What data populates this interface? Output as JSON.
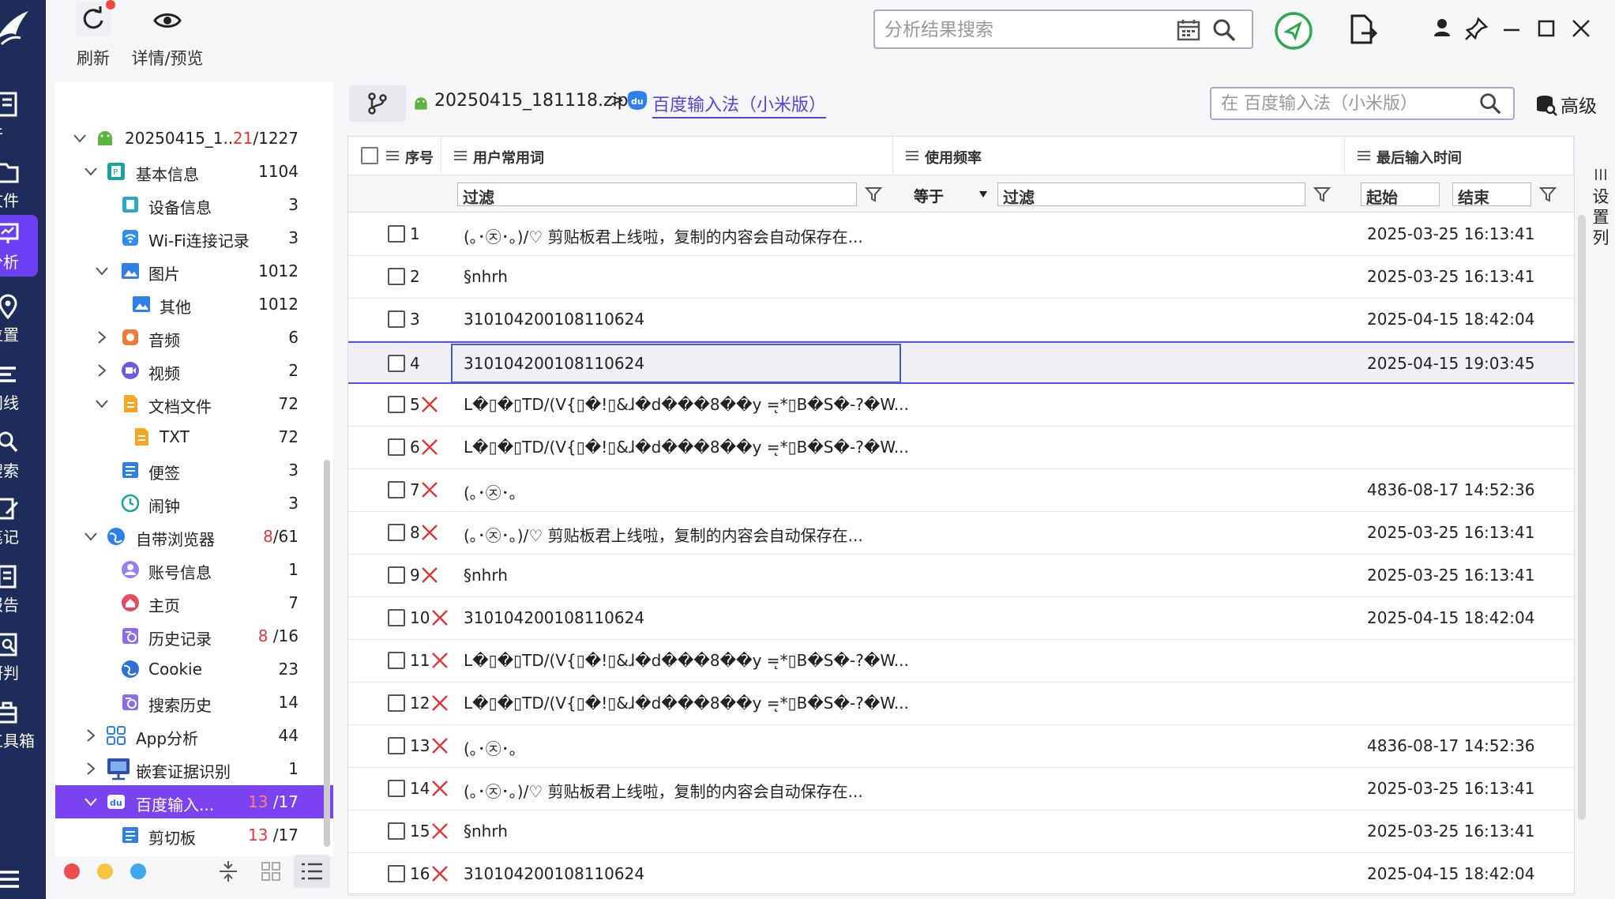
{
  "toolbar": {
    "refresh_label": "刷新",
    "preview_label": "详情/预览",
    "search_placeholder": "分析结果搜索"
  },
  "rail": {
    "items": [
      {
        "label": "件",
        "icon": "document-icon"
      },
      {
        "label": "文件",
        "icon": "folder-icon"
      },
      {
        "label": "分析",
        "icon": "analysis-icon"
      },
      {
        "label": "位置",
        "icon": "location-icon"
      },
      {
        "label": "间线",
        "icon": "timeline-icon"
      },
      {
        "label": "搜索",
        "icon": "search-icon"
      },
      {
        "label": "笔记",
        "icon": "note-icon"
      },
      {
        "label": "报告",
        "icon": "report-icon"
      },
      {
        "label": "研判",
        "icon": "judge-icon"
      },
      {
        "label": "工具箱",
        "icon": "toolbox-icon"
      }
    ]
  },
  "tree": {
    "nodes": [
      {
        "label": "20250415_1...",
        "count_red": "21",
        "count": "/1227"
      },
      {
        "label": "基本信息",
        "count_red": "",
        "count": "1104"
      },
      {
        "label": "设备信息",
        "count_red": "",
        "count": "3"
      },
      {
        "label": "Wi-Fi连接记录",
        "count_red": "",
        "count": "3"
      },
      {
        "label": "图片",
        "count_red": "",
        "count": "1012"
      },
      {
        "label": "其他",
        "count_red": "",
        "count": "1012"
      },
      {
        "label": "音频",
        "count_red": "",
        "count": "6"
      },
      {
        "label": "视频",
        "count_red": "",
        "count": "2"
      },
      {
        "label": "文档文件",
        "count_red": "",
        "count": "72"
      },
      {
        "label": "TXT",
        "count_red": "",
        "count": "72"
      },
      {
        "label": "便签",
        "count_red": "",
        "count": "3"
      },
      {
        "label": "闹钟",
        "count_red": "",
        "count": "3"
      },
      {
        "label": "自带浏览器",
        "count_red": "8",
        "count": "/61"
      },
      {
        "label": "账号信息",
        "count_red": "",
        "count": "1"
      },
      {
        "label": "主页",
        "count_red": "",
        "count": "7"
      },
      {
        "label": "历史记录",
        "count_red": "8",
        "count": " /16"
      },
      {
        "label": "Cookie",
        "count_red": "",
        "count": "23"
      },
      {
        "label": "搜索历史",
        "count_red": "",
        "count": "14"
      },
      {
        "label": "App分析",
        "count_red": "",
        "count": "44"
      },
      {
        "label": "嵌套证据识别",
        "count_red": "",
        "count": "1"
      },
      {
        "label": "百度输入...",
        "count_red": "13",
        "count": " /17"
      },
      {
        "label": "剪切板",
        "count_red": "13",
        "count": " /17"
      }
    ]
  },
  "breadcrumb": {
    "archive": "20250415_181118.zip",
    "separator": ">",
    "app": "百度输入法（小米版）"
  },
  "app_search": {
    "placeholder": "在 百度输入法（小米版）"
  },
  "advanced_label": "高级",
  "columns": {
    "seq": "序号",
    "word": "用户常用词",
    "freq": "使用频率",
    "last_time": "最后输入时间"
  },
  "filters": {
    "word": "过滤",
    "freq_op": "等于",
    "freq": "过滤",
    "start": "起始",
    "end": "结束"
  },
  "column_settings": "设置列",
  "rows": [
    {
      "no": "1",
      "deleted": false,
      "word": "(｡･㉨･｡)/♡ 剪贴板君上线啦，复制的内容会自动保存在...",
      "time": "2025-03-25 16:13:41"
    },
    {
      "no": "2",
      "deleted": false,
      "word": "§nhrh",
      "time": "2025-03-25 16:13:41"
    },
    {
      "no": "3",
      "deleted": false,
      "word": "310104200108110624",
      "time": "2025-04-15 18:42:04"
    },
    {
      "no": "4",
      "deleted": false,
      "word": "310104200108110624",
      "time": "2025-04-15 19:03:45"
    },
    {
      "no": "5",
      "deleted": true,
      "word": "L�▯�▯TD/(V{▯�!▯&ɺ�d���8��y =̨*▯B�S�-?�W...",
      "time": ""
    },
    {
      "no": "6",
      "deleted": true,
      "word": "L�▯�▯TD/(V{▯�!▯&ɺ�d���8��y =̨*▯B�S�-?�W...",
      "time": ""
    },
    {
      "no": "7",
      "deleted": true,
      "word": "(｡･㉨･｡",
      "time": "4836-08-17 14:52:36"
    },
    {
      "no": "8",
      "deleted": true,
      "word": "(｡･㉨･｡)/♡ 剪贴板君上线啦，复制的内容会自动保存在...",
      "time": "2025-03-25 16:13:41"
    },
    {
      "no": "9",
      "deleted": true,
      "word": "§nhrh",
      "time": "2025-03-25 16:13:41"
    },
    {
      "no": "10",
      "deleted": true,
      "word": "310104200108110624",
      "time": "2025-04-15 18:42:04"
    },
    {
      "no": "11",
      "deleted": true,
      "word": "L�▯�▯TD/(V{▯�!▯&ɺ�d���8��y =̨*▯B�S�-?�W...",
      "time": ""
    },
    {
      "no": "12",
      "deleted": true,
      "word": "L�▯�▯TD/(V{▯�!▯&ɺ�d���8��y =̨*▯B�S�-?�W...",
      "time": ""
    },
    {
      "no": "13",
      "deleted": true,
      "word": "(｡･㉨･｡",
      "time": "4836-08-17 14:52:36"
    },
    {
      "no": "14",
      "deleted": true,
      "word": "(｡･㉨･｡)/♡ 剪贴板君上线啦，复制的内容会自动保存在...",
      "time": "2025-03-25 16:13:41"
    },
    {
      "no": "15",
      "deleted": true,
      "word": "§nhrh",
      "time": "2025-03-25 16:13:41"
    },
    {
      "no": "16",
      "deleted": true,
      "word": "310104200108110624",
      "time": "2025-04-15 18:42:04"
    }
  ],
  "colors": {
    "rail_bg": "#1d2c5a",
    "accent": "#7b43f0",
    "deleted": "#e03a3a",
    "selection_border": "#5b4ff0"
  }
}
